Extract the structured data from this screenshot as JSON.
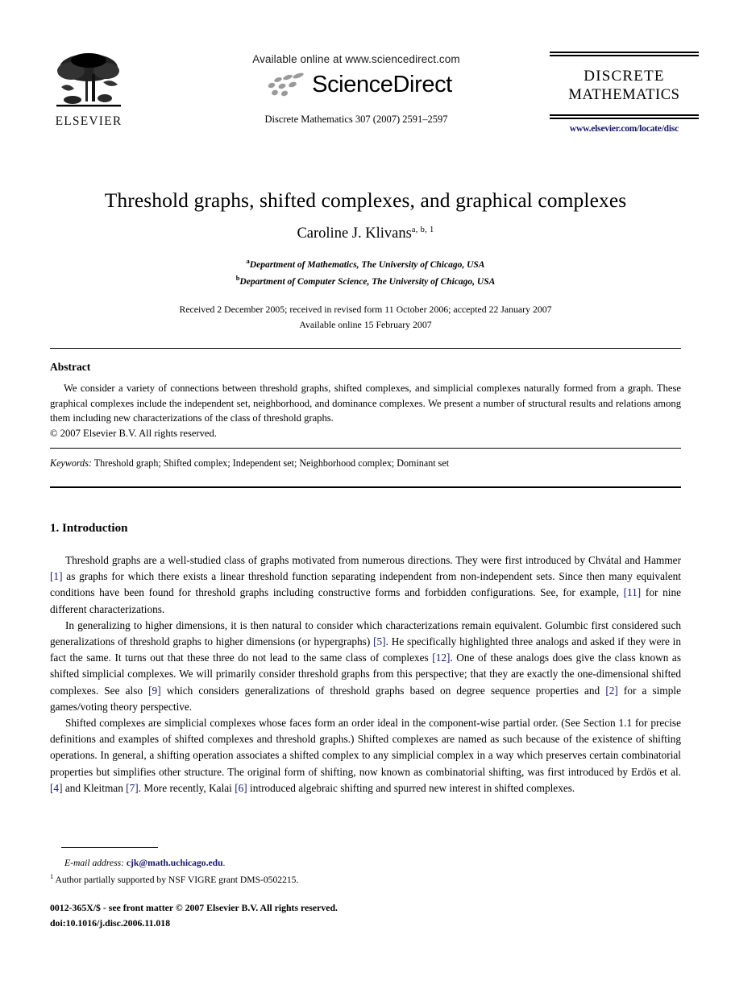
{
  "masthead": {
    "publisher_name": "ELSEVIER",
    "available_online": "Available online at www.sciencedirect.com",
    "sciencedirect_wordmark": "ScienceDirect",
    "journal_reference": "Discrete Mathematics 307 (2007) 2591–2597",
    "journal_logo_line1": "DISCRETE",
    "journal_logo_line2": "MATHEMATICS",
    "journal_url": "www.elsevier.com/locate/disc",
    "link_color": "#16166b"
  },
  "title_block": {
    "title": "Threshold graphs, shifted complexes, and graphical complexes",
    "author_name": "Caroline J. Klivans",
    "author_superscripts": "a, b, 1",
    "affiliations": [
      {
        "marker": "a",
        "text": "Department of Mathematics, The University of Chicago, USA"
      },
      {
        "marker": "b",
        "text": "Department of Computer Science, The University of Chicago, USA"
      }
    ],
    "history_received": "Received 2 December 2005; received in revised form 11 October 2006; accepted 22 January 2007",
    "history_online": "Available online 15 February 2007"
  },
  "abstract": {
    "heading": "Abstract",
    "text": "We consider a variety of connections between threshold graphs, shifted complexes, and simplicial complexes naturally formed from a graph. These graphical complexes include the independent set, neighborhood, and dominance complexes. We present a number of structural results and relations among them including new characterizations of the class of threshold graphs.",
    "copyright": "© 2007 Elsevier B.V. All rights reserved."
  },
  "keywords": {
    "label": "Keywords:",
    "text": " Threshold graph; Shifted complex; Independent set; Neighborhood complex; Dominant set"
  },
  "section": {
    "number_and_title": "1.  Introduction"
  },
  "paragraphs": {
    "p1": {
      "part1": "Threshold graphs are a well-studied class of graphs motivated from numerous directions. They were first introduced by Chvátal and Hammer ",
      "cite1": "[1]",
      "part2": " as graphs for which there exists a linear threshold function separating independent from non-independent sets. Since then many equivalent conditions have been found for threshold graphs including constructive forms and forbidden configurations. See, for example, ",
      "cite2": "[11]",
      "part3": " for nine different characterizations."
    },
    "p2": {
      "part1": "In generalizing to higher dimensions, it is then natural to consider which characterizations remain equivalent. Golumbic first considered such generalizations of threshold graphs to higher dimensions (or hypergraphs) ",
      "cite1": "[5]",
      "part2": ". He specifically highlighted three analogs and asked if they were in fact the same. It turns out that these three do not lead to the same class of complexes ",
      "cite2": "[12]",
      "part3": ". One of these analogs does give the class known as shifted simplicial complexes. We will primarily consider threshold graphs from this perspective; that they are exactly the one-dimensional shifted complexes. See also ",
      "cite3": "[9]",
      "part4": " which considers generalizations of threshold graphs based on degree sequence properties and ",
      "cite4": "[2]",
      "part5": " for a simple games/voting theory perspective."
    },
    "p3": {
      "part1": "Shifted complexes are simplicial complexes whose faces form an order ideal in the component-wise partial order. (See Section 1.1 for precise definitions and examples of shifted complexes and threshold graphs.) Shifted complexes are named as such because of the existence of shifting operations. In general, a shifting operation associates a shifted complex to any simplicial complex in a way which preserves certain combinatorial properties but simplifies other structure. The original form of shifting, now known as combinatorial shifting, was first introduced by Erdös et al. ",
      "cite1": "[4]",
      "part2": " and Kleitman ",
      "cite2": "[7]",
      "part3": ". More recently, Kalai ",
      "cite3": "[6]",
      "part4": " introduced algebraic shifting and spurred new interest in shifted complexes."
    }
  },
  "footnotes": {
    "email_label": "E-mail address:",
    "email_address": "cjk@math.uchicago.edu",
    "email_trailing": ".",
    "grant_marker": "1",
    "grant_text": " Author partially supported by NSF VIGRE grant DMS-0502215."
  },
  "colophon": {
    "front_matter": "0012-365X/$ - see front matter © 2007 Elsevier B.V. All rights reserved.",
    "doi": "doi:10.1016/j.disc.2006.11.018"
  }
}
